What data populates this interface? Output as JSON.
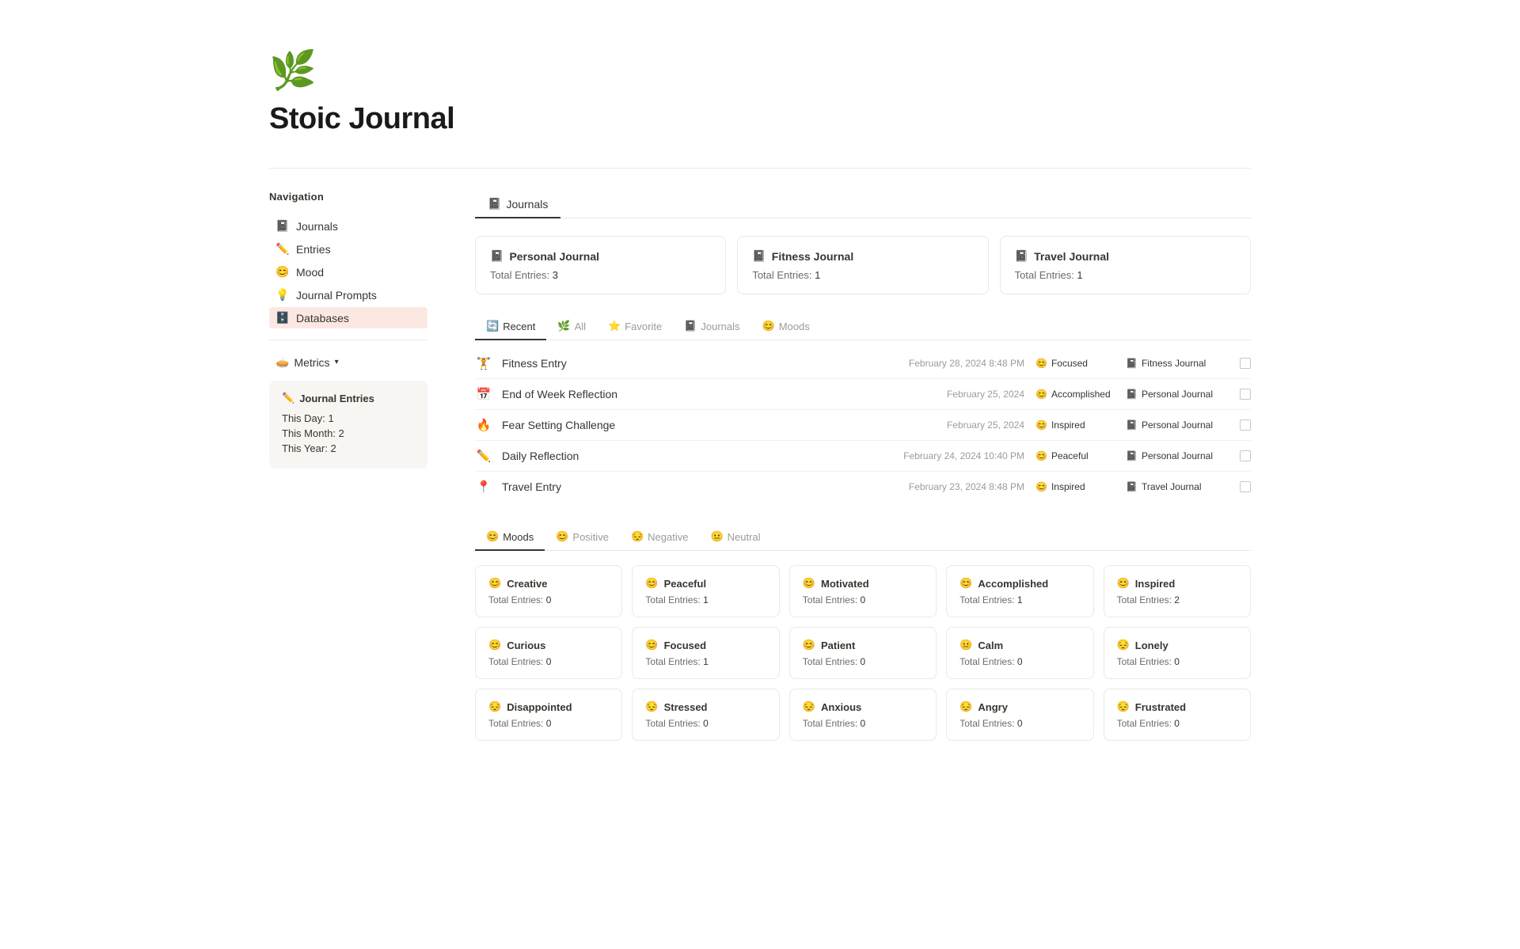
{
  "header": {
    "logo": "🌿",
    "title": "Stoic Journal"
  },
  "sidebar": {
    "nav_title": "Navigation",
    "nav_items": [
      {
        "id": "journals",
        "icon": "📓",
        "label": "Journals",
        "active": false
      },
      {
        "id": "entries",
        "icon": "✏️",
        "label": "Entries",
        "active": false
      },
      {
        "id": "mood",
        "icon": "😊",
        "label": "Mood",
        "active": false
      },
      {
        "id": "journal-prompts",
        "icon": "💡",
        "label": "Journal Prompts",
        "active": false
      },
      {
        "id": "databases",
        "icon": "🗄️",
        "label": "Databases",
        "active": true
      }
    ],
    "metrics_label": "Metrics",
    "journal_entries": {
      "title": "Journal Entries",
      "this_day_label": "This Day:",
      "this_day_value": "1",
      "this_month_label": "This Month:",
      "this_month_value": "2",
      "this_year_label": "This Year:",
      "this_year_value": "2"
    }
  },
  "main": {
    "journals_tab": "Journals",
    "journals": [
      {
        "icon": "📓",
        "name": "Personal Journal",
        "count_label": "Total Entries:",
        "count": "3"
      },
      {
        "icon": "📓",
        "name": "Fitness Journal",
        "count_label": "Total Entries:",
        "count": "1"
      },
      {
        "icon": "📓",
        "name": "Travel Journal",
        "count_label": "Total Entries:",
        "count": "1"
      }
    ],
    "filter_tabs": [
      {
        "id": "recent",
        "icon": "🔄",
        "label": "Recent",
        "active": true
      },
      {
        "id": "all",
        "icon": "🌿",
        "label": "All",
        "active": false
      },
      {
        "id": "favorite",
        "icon": "⭐",
        "label": "Favorite",
        "active": false
      },
      {
        "id": "journals",
        "icon": "📓",
        "label": "Journals",
        "active": false
      },
      {
        "id": "moods-tab",
        "icon": "😊",
        "label": "Moods",
        "active": false
      }
    ],
    "entries": [
      {
        "icon": "🏋️",
        "name": "Fitness Entry",
        "date": "February 28, 2024 8:48 PM",
        "mood": "Focused",
        "mood_icon": "😊",
        "journal": "Fitness Journal",
        "journal_icon": "📓"
      },
      {
        "icon": "📅",
        "name": "End of Week Reflection",
        "date": "February 25, 2024",
        "mood": "Accomplished",
        "mood_icon": "😊",
        "journal": "Personal Journal",
        "journal_icon": "📓"
      },
      {
        "icon": "🔥",
        "name": "Fear Setting Challenge",
        "date": "February 25, 2024",
        "mood": "Inspired",
        "mood_icon": "😊",
        "journal": "Personal Journal",
        "journal_icon": "📓"
      },
      {
        "icon": "✏️",
        "name": "Daily Reflection",
        "date": "February 24, 2024 10:40 PM",
        "mood": "Peaceful",
        "mood_icon": "😊",
        "journal": "Personal Journal",
        "journal_icon": "📓"
      },
      {
        "icon": "📍",
        "name": "Travel Entry",
        "date": "February 23, 2024 8:48 PM",
        "mood": "Inspired",
        "mood_icon": "😊",
        "journal": "Travel Journal",
        "journal_icon": "📓"
      }
    ],
    "moods_section_label": "Moods",
    "mood_filter_tabs": [
      {
        "id": "moods-all",
        "icon": "😊",
        "label": "Moods",
        "active": true
      },
      {
        "id": "positive",
        "icon": "😊",
        "label": "Positive",
        "active": false
      },
      {
        "id": "negative",
        "icon": "😔",
        "label": "Negative",
        "active": false
      },
      {
        "id": "neutral",
        "icon": "😐",
        "label": "Neutral",
        "active": false
      }
    ],
    "moods": [
      {
        "icon": "😊",
        "name": "Creative",
        "count_label": "Total Entries:",
        "count": "0"
      },
      {
        "icon": "😊",
        "name": "Peaceful",
        "count_label": "Total Entries:",
        "count": "1"
      },
      {
        "icon": "😊",
        "name": "Motivated",
        "count_label": "Total Entries:",
        "count": "0"
      },
      {
        "icon": "😊",
        "name": "Accomplished",
        "count_label": "Total Entries:",
        "count": "1"
      },
      {
        "icon": "😊",
        "name": "Inspired",
        "count_label": "Total Entries:",
        "count": "2"
      },
      {
        "icon": "😊",
        "name": "Curious",
        "count_label": "Total Entries:",
        "count": "0"
      },
      {
        "icon": "😊",
        "name": "Focused",
        "count_label": "Total Entries:",
        "count": "1"
      },
      {
        "icon": "😊",
        "name": "Patient",
        "count_label": "Total Entries:",
        "count": "0"
      },
      {
        "icon": "😐",
        "name": "Calm",
        "count_label": "Total Entries:",
        "count": "0"
      },
      {
        "icon": "😔",
        "name": "Lonely",
        "count_label": "Total Entries:",
        "count": "0"
      },
      {
        "icon": "😔",
        "name": "Disappointed",
        "count_label": "Total Entries:",
        "count": "0"
      },
      {
        "icon": "😔",
        "name": "Stressed",
        "count_label": "Total Entries:",
        "count": "0"
      },
      {
        "icon": "😔",
        "name": "Anxious",
        "count_label": "Total Entries:",
        "count": "0"
      },
      {
        "icon": "😔",
        "name": "Angry",
        "count_label": "Total Entries:",
        "count": "0"
      },
      {
        "icon": "😔",
        "name": "Frustrated",
        "count_label": "Total Entries:",
        "count": "0"
      }
    ]
  }
}
